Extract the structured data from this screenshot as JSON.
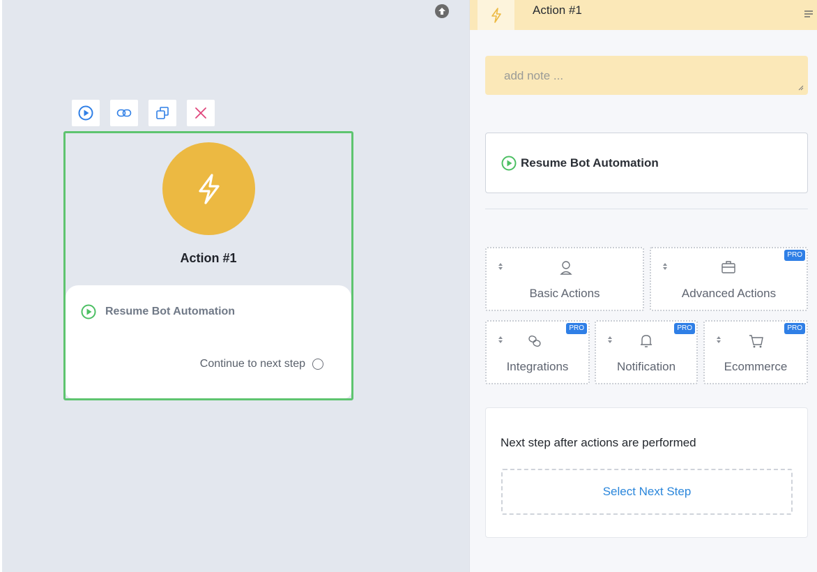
{
  "node": {
    "title": "Action #1",
    "action_label": "Resume Bot Automation",
    "continue_label": "Continue to next step"
  },
  "panel": {
    "title": "Action #1",
    "note_placeholder": "add note ...",
    "selected_action": "Resume Bot Automation",
    "categories": [
      {
        "label": "Basic Actions",
        "pro": ""
      },
      {
        "label": "Advanced Actions",
        "pro": "PRO"
      },
      {
        "label": "Integrations",
        "pro": "PRO"
      },
      {
        "label": "Notification",
        "pro": "PRO"
      },
      {
        "label": "Ecommerce",
        "pro": "PRO"
      }
    ],
    "next_step": {
      "title": "Next step after actions are performed",
      "button": "Select Next Step"
    }
  },
  "colors": {
    "accent_green": "#5ec46f",
    "action_orange": "#ecb942",
    "link_blue": "#2a86db",
    "pro_badge": "#2f7fe6",
    "note_yellow": "#fbe8b8"
  },
  "icons": {
    "toolbar": [
      "play-icon",
      "link-icon",
      "duplicate-icon",
      "delete-icon"
    ],
    "node": "lightning-icon",
    "categories": [
      "user-icon",
      "briefcase-icon",
      "chain-icon",
      "bell-icon",
      "cart-icon"
    ]
  }
}
